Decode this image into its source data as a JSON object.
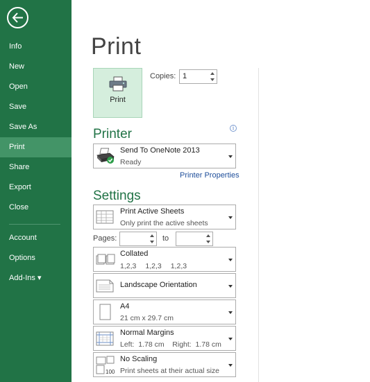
{
  "sidebar": {
    "back_icon": "back-arrow-icon",
    "items": [
      {
        "label": "Info"
      },
      {
        "label": "New"
      },
      {
        "label": "Open"
      },
      {
        "label": "Save"
      },
      {
        "label": "Save As"
      },
      {
        "label": "Print",
        "active": true
      },
      {
        "label": "Share"
      },
      {
        "label": "Export"
      },
      {
        "label": "Close"
      }
    ],
    "lower_items": [
      {
        "label": "Account"
      },
      {
        "label": "Options"
      },
      {
        "label": "Add-Ins ▾"
      }
    ]
  },
  "page": {
    "title": "Print"
  },
  "print": {
    "button_label": "Print",
    "copies_label": "Copies:",
    "copies_value": "1"
  },
  "printer": {
    "heading": "Printer",
    "name": "Send To OneNote 2013",
    "status": "Ready",
    "properties_link": "Printer Properties"
  },
  "settings": {
    "heading": "Settings",
    "what": {
      "title": "Print Active Sheets",
      "subtitle": "Only print the active sheets"
    },
    "pages_label": "Pages:",
    "to_label": "to",
    "pages_from": "",
    "pages_to": "",
    "collation": {
      "title": "Collated",
      "nums": [
        "1,2,3",
        "1,2,3",
        "1,2,3"
      ]
    },
    "orientation": {
      "title": "Landscape Orientation"
    },
    "paper": {
      "title": "A4",
      "subtitle": "21 cm x 29.7 cm"
    },
    "margins": {
      "title": "Normal Margins",
      "subtitle": "Left:  1.78 cm    Right:  1.78 cm"
    },
    "scaling": {
      "title": "No Scaling",
      "subtitle": "Print sheets at their actual size"
    }
  },
  "colors": {
    "accent": "#217346",
    "active_nav": "#439467",
    "print_button_bg": "#d5eedd",
    "link": "#1e4e9a"
  }
}
